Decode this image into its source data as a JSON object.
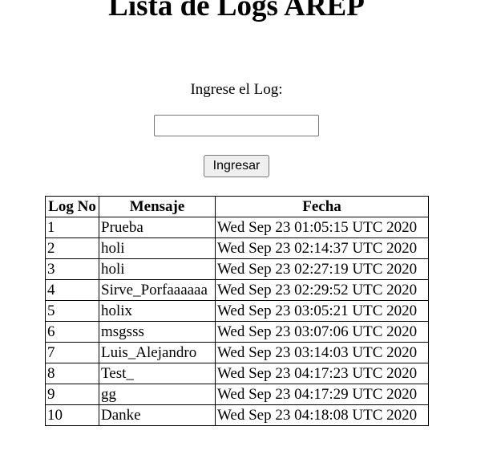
{
  "page": {
    "title": "Lista de Logs AREP"
  },
  "form": {
    "label": "Ingrese el Log:",
    "input_value": "",
    "submit_label": "Ingresar"
  },
  "table": {
    "headers": [
      "Log No",
      "Mensaje",
      "Fecha"
    ],
    "rows": [
      [
        "1",
        "Prueba",
        "Wed Sep 23 01:05:15 UTC 2020"
      ],
      [
        "2",
        "holi",
        "Wed Sep 23 02:14:37 UTC 2020"
      ],
      [
        "3",
        "holi",
        "Wed Sep 23 02:27:19 UTC 2020"
      ],
      [
        "4",
        "Sirve_Porfaaaaaa",
        "Wed Sep 23 02:29:52 UTC 2020"
      ],
      [
        "5",
        "holix",
        "Wed Sep 23 03:05:21 UTC 2020"
      ],
      [
        "6",
        "msgsss",
        "Wed Sep 23 03:07:06 UTC 2020"
      ],
      [
        "7",
        "Luis_Alejandro",
        "Wed Sep 23 03:14:03 UTC 2020"
      ],
      [
        "8",
        "Test_",
        "Wed Sep 23 04:17:23 UTC 2020"
      ],
      [
        "9",
        "gg",
        "Wed Sep 23 04:17:29 UTC 2020"
      ],
      [
        "10",
        "Danke",
        "Wed Sep 23 04:18:08 UTC 2020"
      ]
    ]
  }
}
